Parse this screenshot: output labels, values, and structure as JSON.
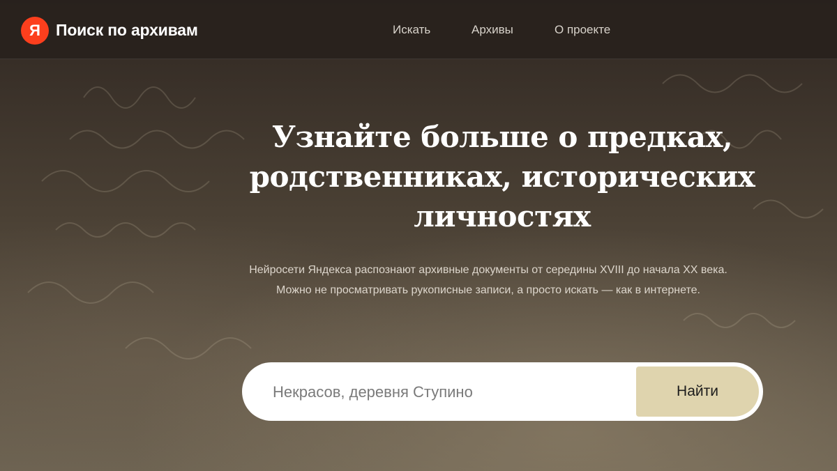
{
  "header": {
    "logo_letter": "Я",
    "title": "Поиск по архивам",
    "nav": [
      {
        "label": "Искать"
      },
      {
        "label": "Архивы"
      },
      {
        "label": "О проекте"
      }
    ]
  },
  "hero": {
    "title_line1": "Узнайте больше о предках,",
    "title_line2": "родственниках, исторических",
    "title_line3": "личностях",
    "subtitle_line1": "Нейросети Яндекса распознают архивные документы от середины XVIII до начала XX века.",
    "subtitle_line2": "Можно не просматривать рукописные записи, а просто искать — как в интернете."
  },
  "search": {
    "placeholder": "Некрасов, деревня Ступино",
    "button_label": "Найти"
  },
  "colors": {
    "brand": "#fc3f1d",
    "button": "#dfd4ae",
    "header": "#28211c"
  }
}
